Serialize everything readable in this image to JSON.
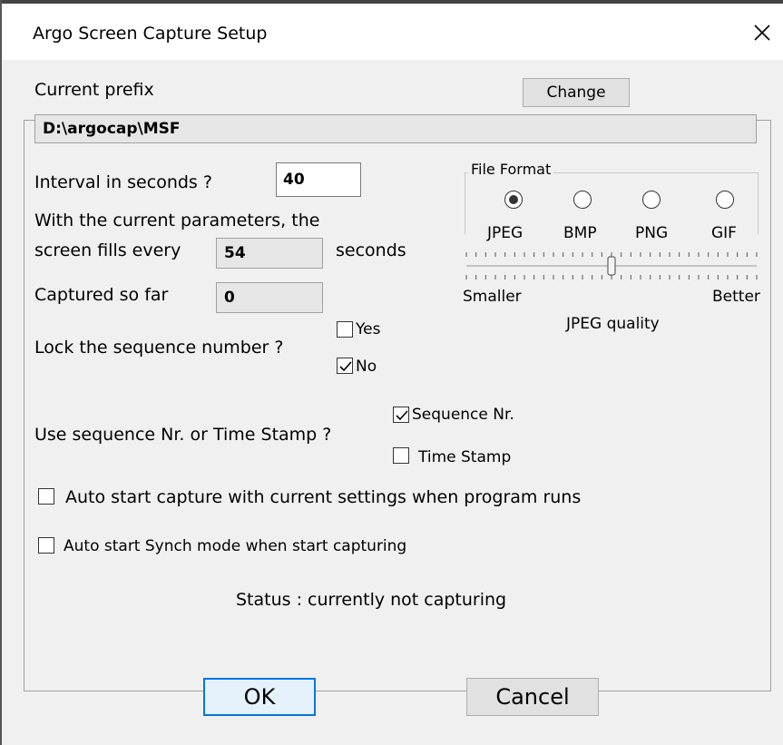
{
  "window": {
    "title": "Argo Screen Capture Setup"
  },
  "prefix": {
    "label": "Current prefix",
    "change_button": "Change",
    "value": "D:\\argocap\\MSF"
  },
  "interval": {
    "label": "Interval in seconds ?",
    "value": "40"
  },
  "fill": {
    "line1": "With the current parameters, the",
    "line2_prefix": "screen fills every",
    "value": "54",
    "unit": "seconds"
  },
  "captured": {
    "label": "Captured so far",
    "value": "0"
  },
  "lock": {
    "label": "Lock the sequence number ?",
    "yes_label": "Yes",
    "yes_checked": false,
    "no_label": "No",
    "no_checked": true
  },
  "sequence": {
    "label": "Use sequence Nr. or Time Stamp ?",
    "seq_label": "Sequence Nr.",
    "seq_checked": true,
    "time_label": "Time Stamp",
    "time_checked": false
  },
  "file_format": {
    "legend": "File Format",
    "options": [
      "JPEG",
      "BMP",
      "PNG",
      "GIF"
    ],
    "selected": "JPEG",
    "quality_min_label": "Smaller",
    "quality_max_label": "Better",
    "quality_label": "JPEG quality",
    "quality_fraction": 0.5
  },
  "auto_start": {
    "label": "Auto start capture with current settings when program runs",
    "checked": false
  },
  "auto_synch": {
    "label": "Auto start Synch mode when start capturing",
    "checked": false
  },
  "status": {
    "text": "Status : currently not capturing"
  },
  "buttons": {
    "ok": "OK",
    "cancel": "Cancel"
  }
}
